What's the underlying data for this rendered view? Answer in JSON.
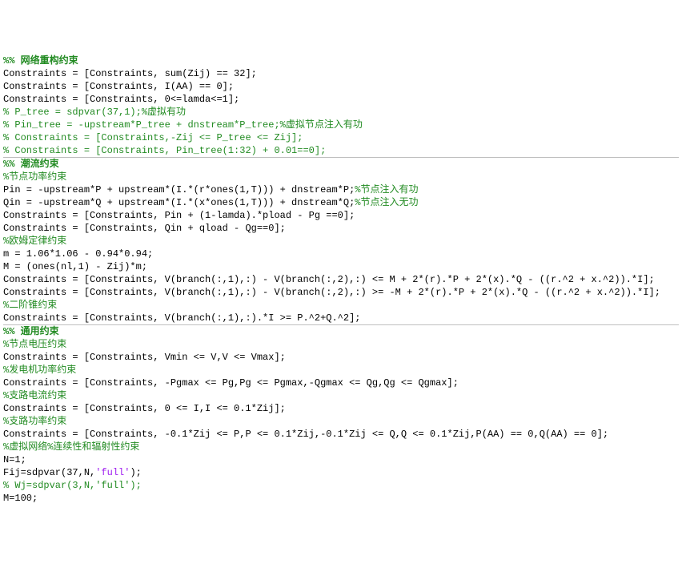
{
  "lines": [
    {
      "type": "section",
      "segments": [
        {
          "cls": "section",
          "text": "%% 网络重构约束"
        }
      ]
    },
    {
      "type": "code",
      "segments": [
        {
          "cls": "black",
          "text": "Constraints = [Constraints, sum(Zij) == 32];"
        }
      ]
    },
    {
      "type": "code",
      "segments": [
        {
          "cls": "black",
          "text": "Constraints = [Constraints, I(AA) == 0];"
        }
      ]
    },
    {
      "type": "code",
      "segments": [
        {
          "cls": "black",
          "text": "Constraints = [Constraints, 0<=lamda<=1];"
        }
      ]
    },
    {
      "type": "code",
      "segments": [
        {
          "cls": "comment",
          "text": "% P_tree = sdpvar(37,1);%虚拟有功"
        }
      ]
    },
    {
      "type": "code",
      "segments": [
        {
          "cls": "comment",
          "text": "% Pin_tree = -upstream*P_tree + dnstream*P_tree;%虚拟节点注入有功"
        }
      ]
    },
    {
      "type": "code",
      "segments": [
        {
          "cls": "comment",
          "text": "% Constraints = [Constraints,-Zij <= P_tree <= Zij];"
        }
      ]
    },
    {
      "type": "code",
      "segments": [
        {
          "cls": "comment",
          "text": "% Constraints = [Constraints, Pin_tree(1:32) + 0.01==0];"
        }
      ]
    },
    {
      "type": "sep"
    },
    {
      "type": "section",
      "segments": [
        {
          "cls": "section",
          "text": "%% 潮流约束"
        }
      ]
    },
    {
      "type": "code",
      "segments": [
        {
          "cls": "comment",
          "text": "%节点功率约束"
        }
      ]
    },
    {
      "type": "code",
      "segments": [
        {
          "cls": "black",
          "text": "Pin = -upstream*P + upstream*(I.*(r*ones(1,T))) + dnstream*P;"
        },
        {
          "cls": "comment",
          "text": "%节点注入有功"
        }
      ]
    },
    {
      "type": "code",
      "segments": [
        {
          "cls": "black",
          "text": "Qin = -upstream*Q + upstream*(I.*(x*ones(1,T))) + dnstream*Q;"
        },
        {
          "cls": "comment",
          "text": "%节点注入无功"
        }
      ]
    },
    {
      "type": "code",
      "segments": [
        {
          "cls": "black",
          "text": "Constraints = [Constraints, Pin + (1-lamda).*pload - Pg ==0];"
        }
      ]
    },
    {
      "type": "code",
      "segments": [
        {
          "cls": "black",
          "text": "Constraints = [Constraints, Qin + qload - Qg==0];"
        }
      ]
    },
    {
      "type": "code",
      "segments": [
        {
          "cls": "comment",
          "text": "%欧姆定律约束"
        }
      ]
    },
    {
      "type": "code",
      "segments": [
        {
          "cls": "black",
          "text": "m = 1.06*1.06 - 0.94*0.94;"
        }
      ]
    },
    {
      "type": "code",
      "segments": [
        {
          "cls": "black",
          "text": "M = (ones(nl,1) - Zij)*m;"
        }
      ]
    },
    {
      "type": "code",
      "segments": [
        {
          "cls": "black",
          "text": "Constraints = [Constraints, V(branch(:,1),:) - V(branch(:,2),:) <= M + 2*(r).*P + 2*(x).*Q - ((r.^2 + x.^2)).*I];"
        }
      ]
    },
    {
      "type": "code",
      "segments": [
        {
          "cls": "black",
          "text": "Constraints = [Constraints, V(branch(:,1),:) - V(branch(:,2),:) >= -M + 2*(r).*P + 2*(x).*Q - ((r.^2 + x.^2)).*I];"
        }
      ]
    },
    {
      "type": "code",
      "segments": [
        {
          "cls": "comment",
          "text": "%二阶锥约束"
        }
      ]
    },
    {
      "type": "code",
      "segments": [
        {
          "cls": "black",
          "text": "Constraints = [Constraints, V(branch(:,1),:).*I >= P.^2+Q.^2];"
        }
      ]
    },
    {
      "type": "sep"
    },
    {
      "type": "section",
      "segments": [
        {
          "cls": "section",
          "text": "%% 通用约束"
        }
      ]
    },
    {
      "type": "code",
      "segments": [
        {
          "cls": "comment",
          "text": "%节点电压约束"
        }
      ]
    },
    {
      "type": "code",
      "segments": [
        {
          "cls": "black",
          "text": "Constraints = [Constraints, Vmin <= V,V <= Vmax];"
        }
      ]
    },
    {
      "type": "code",
      "segments": [
        {
          "cls": "comment",
          "text": "%发电机功率约束"
        }
      ]
    },
    {
      "type": "code",
      "segments": [
        {
          "cls": "black",
          "text": "Constraints = [Constraints, -Pgmax <= Pg,Pg <= Pgmax,-Qgmax <= Qg,Qg <= Qgmax];"
        }
      ]
    },
    {
      "type": "code",
      "segments": [
        {
          "cls": "comment",
          "text": "%支路电流约束"
        }
      ]
    },
    {
      "type": "code",
      "segments": [
        {
          "cls": "black",
          "text": "Constraints = [Constraints, 0 <= I,I <= 0.1*Zij];"
        }
      ]
    },
    {
      "type": "code",
      "segments": [
        {
          "cls": "comment",
          "text": "%支路功率约束"
        }
      ]
    },
    {
      "type": "code",
      "segments": [
        {
          "cls": "black",
          "text": "Constraints = [Constraints, -0.1*Zij <= P,P <= 0.1*Zij,-0.1*Zij <= Q,Q <= 0.1*Zij,P(AA) == 0,Q(AA) == 0];"
        }
      ]
    },
    {
      "type": "code",
      "segments": [
        {
          "cls": "comment",
          "text": "%虚拟网络%连续性和辐射性约束"
        }
      ]
    },
    {
      "type": "code",
      "segments": [
        {
          "cls": "black",
          "text": "N=1;"
        }
      ]
    },
    {
      "type": "code",
      "segments": [
        {
          "cls": "black",
          "text": "Fij=sdpvar(37,N,"
        },
        {
          "cls": "string",
          "text": "'full'"
        },
        {
          "cls": "black",
          "text": ");"
        }
      ]
    },
    {
      "type": "code",
      "segments": [
        {
          "cls": "comment",
          "text": "% Wj=sdpvar(3,N,'full');"
        }
      ]
    },
    {
      "type": "code",
      "segments": [
        {
          "cls": "black",
          "text": "M=100;"
        }
      ]
    }
  ]
}
